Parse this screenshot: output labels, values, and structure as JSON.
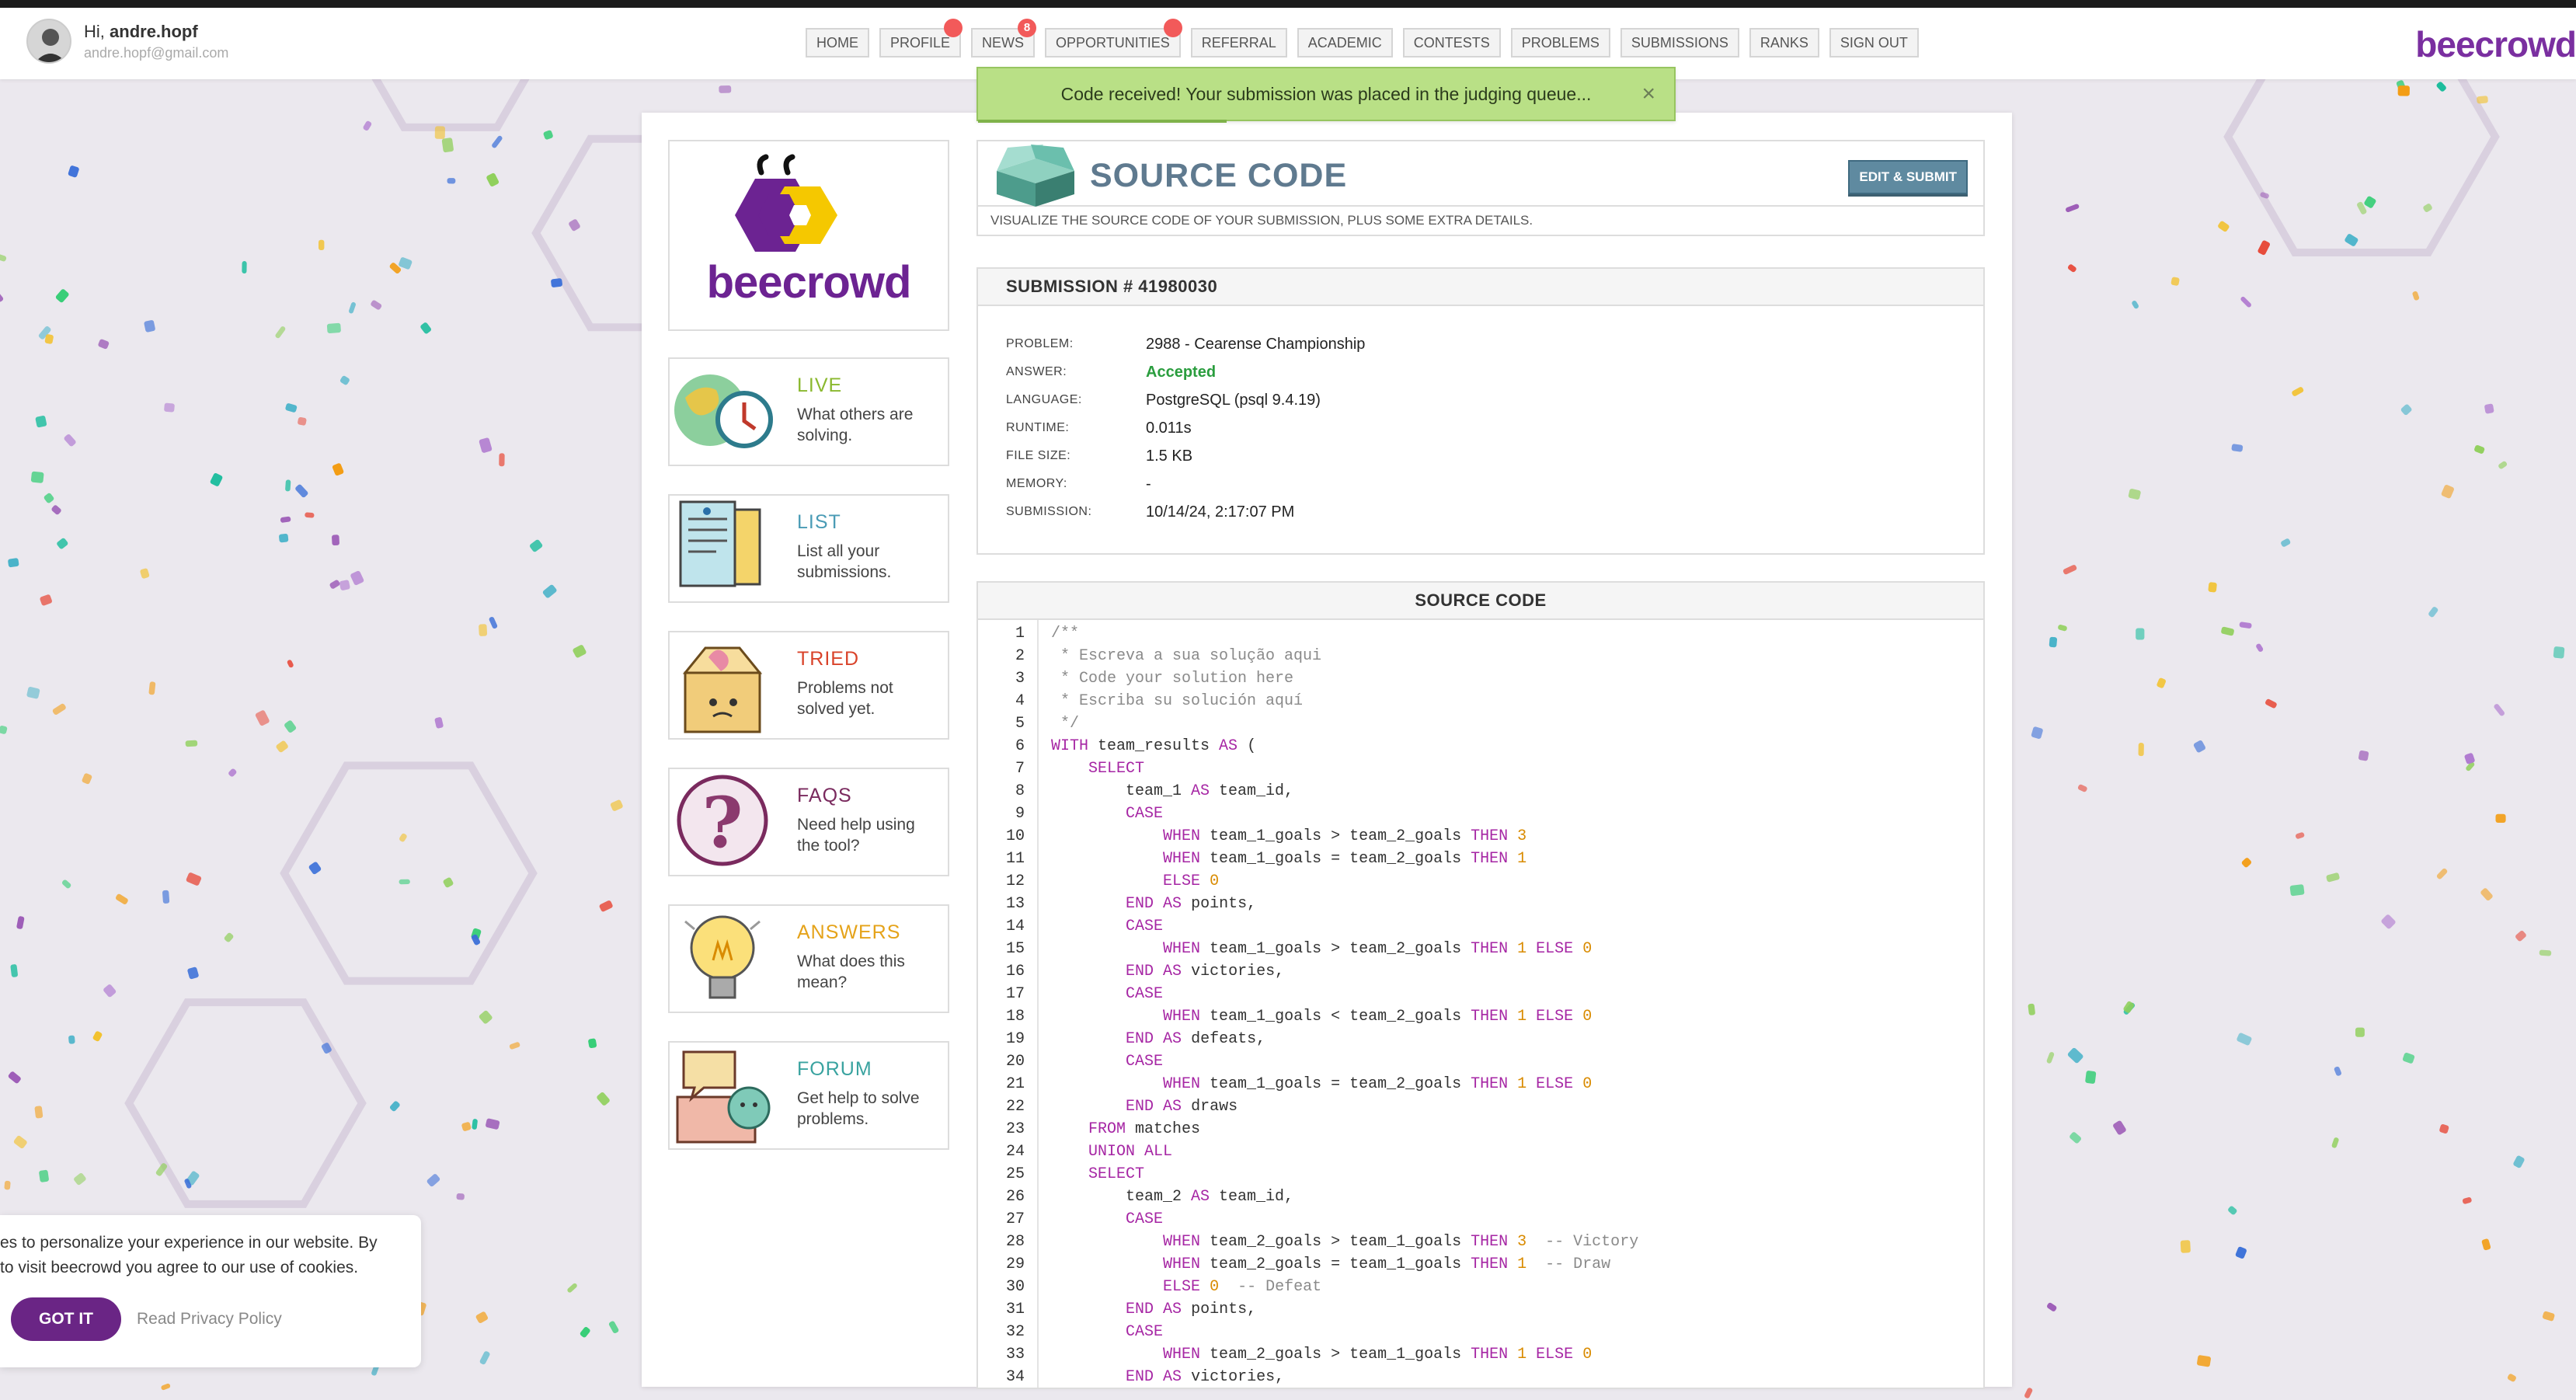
{
  "user": {
    "greeting": "Hi,",
    "name": "andre.hopf",
    "email": "andre.hopf@gmail.com"
  },
  "nav": [
    {
      "label": "HOME",
      "badge": ""
    },
    {
      "label": "PROFILE",
      "badge": " "
    },
    {
      "label": "NEWS",
      "badge": "8"
    },
    {
      "label": "OPPORTUNITIES",
      "badge": " "
    },
    {
      "label": "REFERRAL",
      "badge": ""
    },
    {
      "label": "ACADEMIC",
      "badge": ""
    },
    {
      "label": "CONTESTS",
      "badge": ""
    },
    {
      "label": "PROBLEMS",
      "badge": ""
    },
    {
      "label": "SUBMISSIONS",
      "badge": ""
    },
    {
      "label": "RANKS",
      "badge": ""
    },
    {
      "label": "SIGN OUT",
      "badge": ""
    }
  ],
  "brand": "beecrowd",
  "toast": {
    "message": "Code received! Your submission was placed in the judging queue...",
    "close": "×"
  },
  "sidebar": [
    {
      "title": "LIVE",
      "desc": "What others are solving.",
      "color": "#8ab82e"
    },
    {
      "title": "LIST",
      "desc": "List all your submissions.",
      "color": "#4a9bb5"
    },
    {
      "title": "TRIED",
      "desc": "Problems not solved yet.",
      "color": "#d9432a"
    },
    {
      "title": "FAQS",
      "desc": "Need help using the tool?",
      "color": "#7a2a5e"
    },
    {
      "title": "ANSWERS",
      "desc": "What does this mean?",
      "color": "#e5a31a"
    },
    {
      "title": "FORUM",
      "desc": "Get help to solve problems.",
      "color": "#3aa3a0"
    }
  ],
  "source_header": {
    "title": "SOURCE CODE",
    "button": "EDIT & SUBMIT",
    "subtitle": "VISUALIZE THE SOURCE CODE OF YOUR SUBMISSION, PLUS SOME EXTRA DETAILS."
  },
  "submission": {
    "title": "SUBMISSION # 41980030",
    "rows": [
      {
        "key": "PROBLEM:",
        "value": "2988 - Cearense Championship"
      },
      {
        "key": "ANSWER:",
        "value": "Accepted"
      },
      {
        "key": "LANGUAGE:",
        "value": "PostgreSQL (psql 9.4.19)"
      },
      {
        "key": "RUNTIME:",
        "value": "0.011s"
      },
      {
        "key": "FILE SIZE:",
        "value": "1.5 KB"
      },
      {
        "key": "MEMORY:",
        "value": "-"
      },
      {
        "key": "SUBMISSION:",
        "value": "10/14/24, 2:17:07 PM"
      }
    ]
  },
  "code": {
    "title": "SOURCE CODE",
    "lines": [
      "/**",
      " * Escreva a sua solução aqui",
      " * Code your solution here",
      " * Escriba su solución aquí",
      " */",
      "WITH team_results AS (",
      "    SELECT",
      "        team_1 AS team_id,",
      "        CASE",
      "            WHEN team_1_goals > team_2_goals THEN 3",
      "            WHEN team_1_goals = team_2_goals THEN 1",
      "            ELSE 0",
      "        END AS points,",
      "        CASE",
      "            WHEN team_1_goals > team_2_goals THEN 1 ELSE 0",
      "        END AS victories,",
      "        CASE",
      "            WHEN team_1_goals < team_2_goals THEN 1 ELSE 0",
      "        END AS defeats,",
      "        CASE",
      "            WHEN team_1_goals = team_2_goals THEN 1 ELSE 0",
      "        END AS draws",
      "    FROM matches",
      "    UNION ALL",
      "    SELECT",
      "        team_2 AS team_id,",
      "        CASE",
      "            WHEN team_2_goals > team_1_goals THEN 3  -- Victory",
      "            WHEN team_2_goals = team_1_goals THEN 1  -- Draw",
      "            ELSE 0  -- Defeat",
      "        END AS points,",
      "        CASE",
      "            WHEN team_2_goals > team_1_goals THEN 1 ELSE 0",
      "        END AS victories,"
    ]
  },
  "cookie": {
    "line1": "es to personalize your experience in our website. By",
    "line2": "to visit beecrowd you agree to our use of cookies.",
    "button": "GOT IT",
    "link": "Read Privacy Policy"
  },
  "icons": {
    "close": "close-icon"
  },
  "colors": {
    "brand": "#7a2fa0",
    "accepted": "#2a9d3e",
    "toast": "#b9e086",
    "button": "#6a2585"
  }
}
